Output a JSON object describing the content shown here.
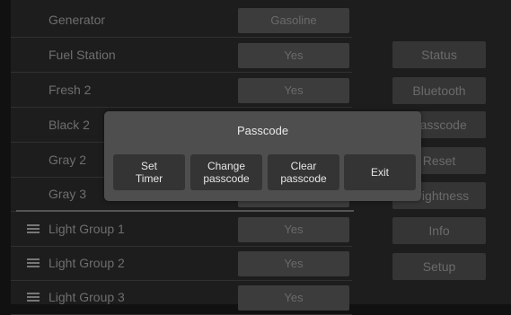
{
  "rows": [
    {
      "label": "Generator",
      "value": "Gasoline"
    },
    {
      "label": "Fuel Station",
      "value": "Yes"
    },
    {
      "label": "Fresh 2",
      "value": "Yes"
    },
    {
      "label": "Black 2",
      "value": ""
    },
    {
      "label": "Gray 2",
      "value": ""
    },
    {
      "label": "Gray 3",
      "value": ""
    }
  ],
  "groups": [
    {
      "label": "Light Group 1",
      "value": "Yes"
    },
    {
      "label": "Light Group 2",
      "value": "Yes"
    },
    {
      "label": "Light Group 3",
      "value": "Yes"
    }
  ],
  "sidebar": {
    "status": "Status",
    "bluetooth": "Bluetooth",
    "passcode": "Passcode",
    "reset": "Reset",
    "brightness": "Brightness",
    "info": "Info",
    "setup": "Setup"
  },
  "dialog": {
    "title": "Passcode",
    "set_timer": "Set\nTimer",
    "change_passcode": "Change\npasscode",
    "clear_passcode": "Clear\npasscode",
    "exit": "Exit"
  }
}
